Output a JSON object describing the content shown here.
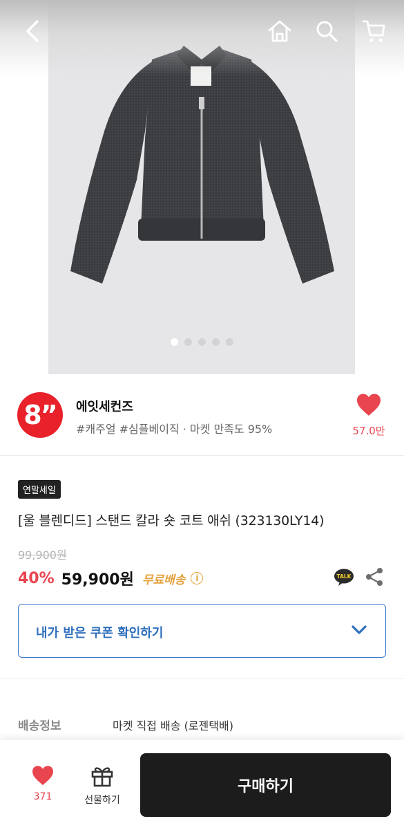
{
  "header": {
    "back_icon": "chevron-left-icon",
    "home_icon": "home-icon",
    "search_icon": "search-icon",
    "cart_icon": "cart-icon"
  },
  "gallery": {
    "image": "product-jacket-photo",
    "total_slides": 5,
    "active_slide": 1
  },
  "seller": {
    "logo_text": "8”",
    "logo_color": "#e8212b",
    "name": "에잇세컨즈",
    "tags": "#캐주얼 #심플베이직 · 마켓 만족도 95%",
    "favorite_count": "57.0만"
  },
  "product": {
    "badge": "연말세일",
    "title": "[울 블렌디드] 스탠드 칼라 숏 코트  애쉬 (323130LY14)",
    "original_price": "99,900원",
    "discount": "40%",
    "price": "59,900원",
    "shipping_badge": "무료배송",
    "info_glyph": "i",
    "talk_label": "TALK"
  },
  "coupon": {
    "label": "내가 받은 쿠폰 확인하기"
  },
  "shipping": {
    "label": "배송정보",
    "value": "마켓 직접 배송 (로젠택배)"
  },
  "bottom_bar": {
    "like_count": "371",
    "gift_label": "선물하기",
    "buy_label": "구매하기"
  },
  "colors": {
    "accent_red": "#e8454f",
    "coupon_blue": "#2f6fbe",
    "free_ship_orange": "#e5a13b",
    "buy_button": "#1c1c1c"
  }
}
